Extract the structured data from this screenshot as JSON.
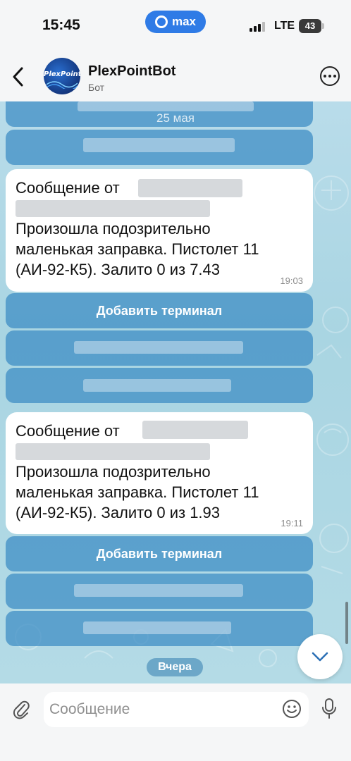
{
  "status_bar": {
    "time": "15:45",
    "app_pill": "max",
    "network": "LTE",
    "battery": "43"
  },
  "header": {
    "avatar_text": "PlexPoint",
    "title": "PlexPointBot",
    "subtitle": "Бот"
  },
  "chat": {
    "top_date": "25 мая",
    "messages": [
      {
        "lines": [
          "Сообщение от",
          "Произошла подозрительно",
          "маленькая заправка. Пистолет 11",
          "(АИ-92-К5). Залито 0 из 7.43"
        ],
        "time": "19:03",
        "keyboard": [
          "Добавить терминал"
        ]
      },
      {
        "lines": [
          "Сообщение от",
          "Произошла подозрительно",
          "маленькая заправка. Пистолет 11",
          "(АИ-92-К5). Залито 0 из 1.93"
        ],
        "time": "19:11",
        "keyboard": [
          "Добавить терминал"
        ]
      }
    ],
    "date_chip": "Вчера"
  },
  "composer": {
    "placeholder": "Сообщение"
  },
  "colors": {
    "accent": "#2f7be6",
    "keyboard_button": "#3a8bc4",
    "chat_background": "#b9dcea"
  },
  "icons": [
    "back-icon",
    "more-icon",
    "scroll-down-icon",
    "attach-icon",
    "emoji-icon",
    "mic-icon"
  ]
}
